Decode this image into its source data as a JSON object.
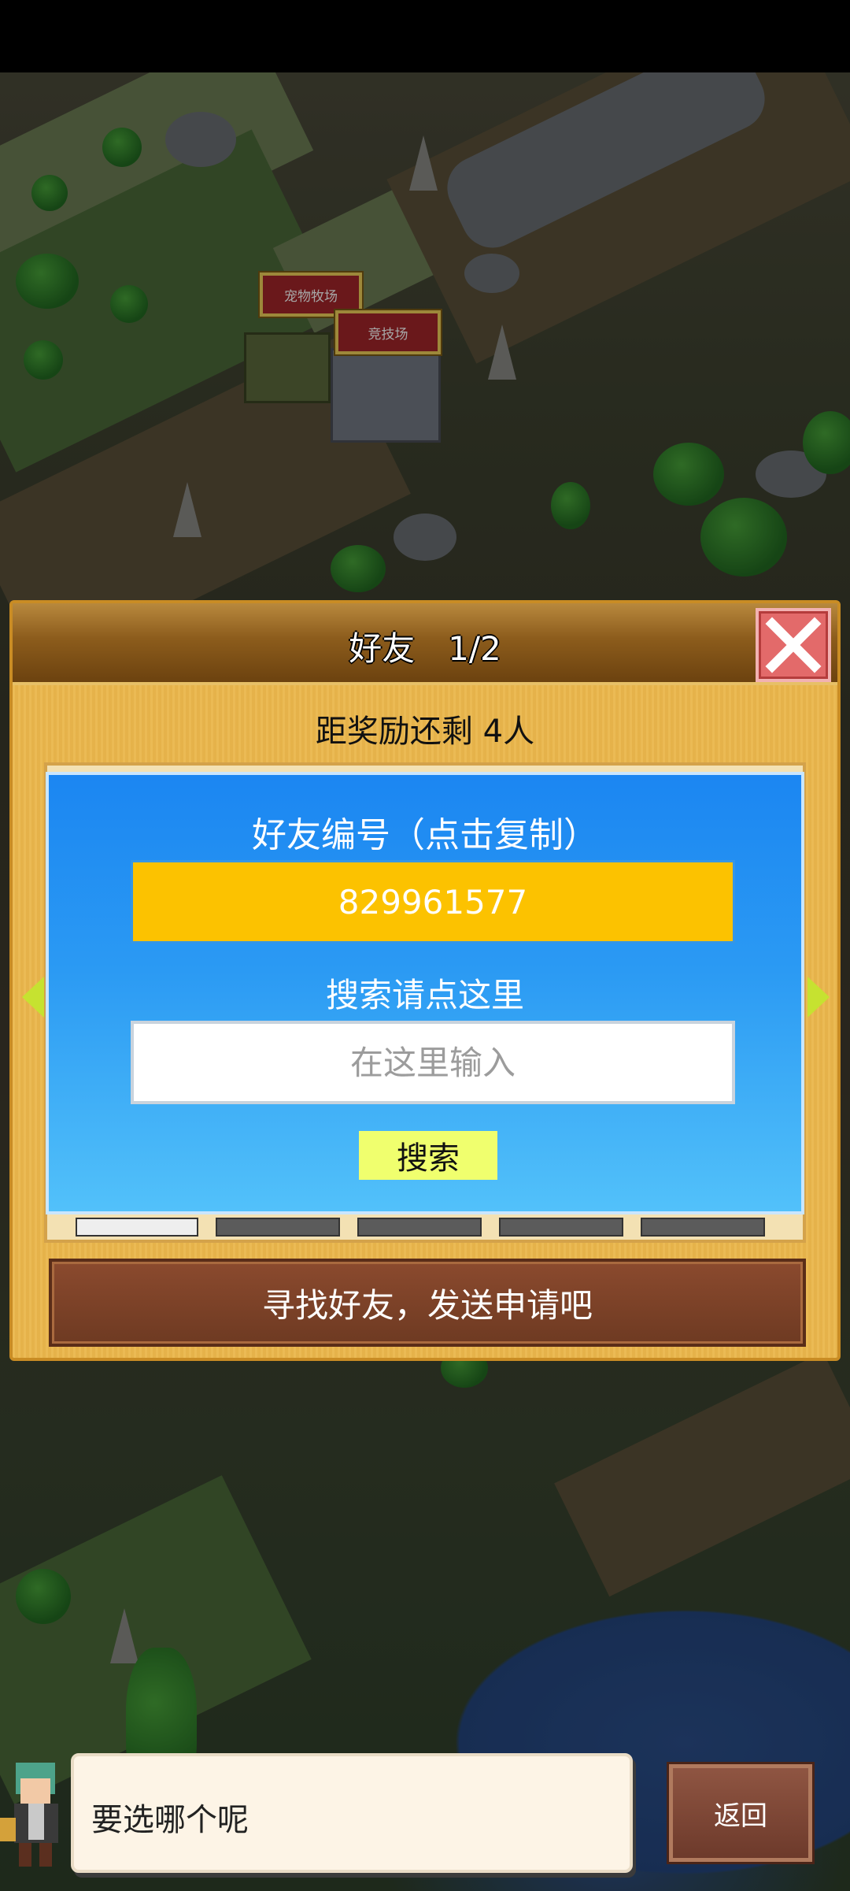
{
  "map": {
    "labels": {
      "pet_ranch": "宠物牧场",
      "arena": "竞技场"
    }
  },
  "friends_panel": {
    "title": "好友　1/2",
    "reward_text": "距奖励还剩 4人",
    "close_icon": "close-x-icon",
    "friend_code_title": "好友编号（点击复制）",
    "friend_code": "829961577",
    "search_hint": "搜索请点这里",
    "search_placeholder": "在这里输入",
    "search_value": "",
    "search_button": "搜索",
    "find_button": "寻找好友，发送申请吧",
    "colors": {
      "panel": "#eab64b",
      "card_top": "#1b86f2",
      "code_box": "#fcc200",
      "search_button": "#f0ff6e"
    }
  },
  "bottom": {
    "dialog_text": "要选哪个呢",
    "back_button": "返回"
  }
}
